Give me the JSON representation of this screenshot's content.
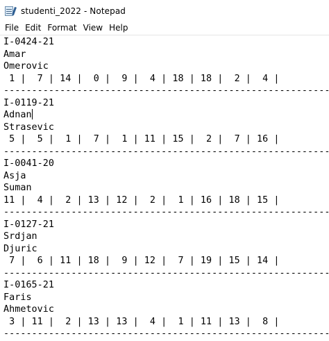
{
  "window": {
    "title": "studenti_2022 - Notepad",
    "app_icon": "notepad-icon"
  },
  "menu": {
    "items": [
      "File",
      "Edit",
      "Format",
      "View",
      "Help"
    ]
  },
  "editor": {
    "caret_line": 8,
    "lines": [
      "I-0424-21",
      "Amar",
      "Omerovic",
      " 1 |  7 | 14 |  0 |  9 |  4 | 18 | 18 |  2 |  4 |",
      "-------------------------------------------------------------",
      "I-0119-21",
      "Adnan",
      "Strasevic",
      " 5 |  5 |  1 |  7 |  1 | 11 | 15 |  2 |  7 | 16 |",
      "-------------------------------------------------------------",
      "I-0041-20",
      "Asja",
      "Suman",
      "11 |  4 |  2 | 13 | 12 |  2 |  1 | 16 | 18 | 15 |",
      "-------------------------------------------------------------",
      "I-0127-21",
      "Srdjan",
      "Djuric",
      " 7 |  6 | 11 | 18 |  9 | 12 |  7 | 19 | 15 | 14 |",
      "-------------------------------------------------------------",
      "I-0165-21",
      "Faris",
      "Ahmetovic",
      " 3 | 11 |  2 | 13 | 13 |  4 |  1 | 11 | 13 |  8 |",
      "-------------------------------------------------------------"
    ]
  }
}
